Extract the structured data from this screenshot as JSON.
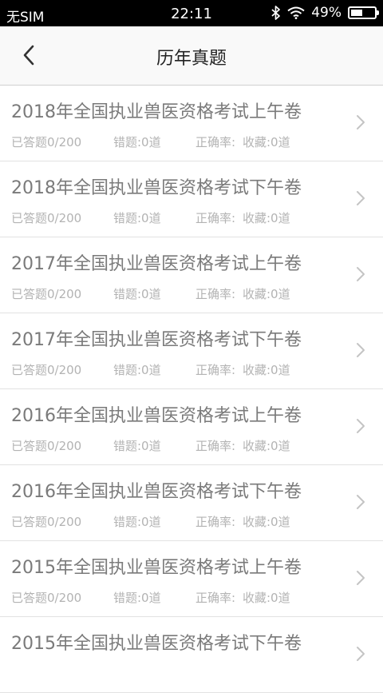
{
  "status_bar": {
    "carrier": "无SIM",
    "time": "22:11",
    "battery_percent": "49%",
    "battery_level": 0.49,
    "icons": [
      "bluetooth-icon",
      "wifi-icon",
      "battery-icon"
    ]
  },
  "header": {
    "title": "历年真题",
    "back_icon": "chevron-left-icon"
  },
  "colors": {
    "title_text": "#7a7a7a",
    "stat_text": "#b3b3b3",
    "divider": "#e2e2e2",
    "navbar_bg": "#f9f9f9"
  },
  "papers": [
    {
      "title": "2018年全国执业兽医资格考试上午卷",
      "answered": "已答题0/200",
      "wrong": "错题:0道",
      "accuracy": "正确率:",
      "favorites": "收藏:0道"
    },
    {
      "title": "2018年全国执业兽医资格考试下午卷",
      "answered": "已答题0/200",
      "wrong": "错题:0道",
      "accuracy": "正确率:",
      "favorites": "收藏:0道"
    },
    {
      "title": "2017年全国执业兽医资格考试上午卷",
      "answered": "已答题0/200",
      "wrong": "错题:0道",
      "accuracy": "正确率:",
      "favorites": "收藏:0道"
    },
    {
      "title": "2017年全国执业兽医资格考试下午卷",
      "answered": "已答题0/200",
      "wrong": "错题:0道",
      "accuracy": "正确率:",
      "favorites": "收藏:0道"
    },
    {
      "title": "2016年全国执业兽医资格考试上午卷",
      "answered": "已答题0/200",
      "wrong": "错题:0道",
      "accuracy": "正确率:",
      "favorites": "收藏:0道"
    },
    {
      "title": "2016年全国执业兽医资格考试下午卷",
      "answered": "已答题0/200",
      "wrong": "错题:0道",
      "accuracy": "正确率:",
      "favorites": "收藏:0道"
    },
    {
      "title": "2015年全国执业兽医资格考试上午卷",
      "answered": "已答题0/200",
      "wrong": "错题:0道",
      "accuracy": "正确率:",
      "favorites": "收藏:0道"
    },
    {
      "title": "2015年全国执业兽医资格考试下午卷",
      "answered": "",
      "wrong": "",
      "accuracy": "",
      "favorites": ""
    }
  ]
}
